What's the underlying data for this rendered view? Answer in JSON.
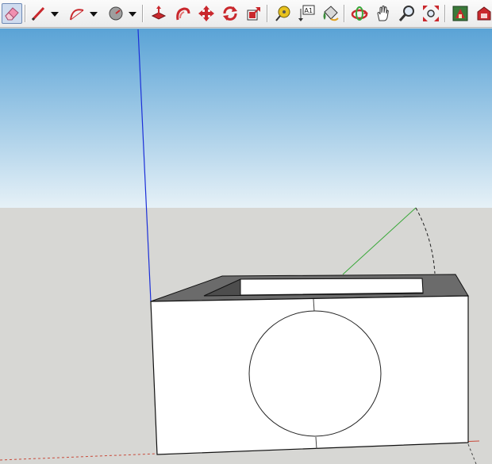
{
  "toolbar": {
    "tools": [
      {
        "id": "eraser",
        "icon": "eraser-icon",
        "active": true
      },
      {
        "id": "pencil-line",
        "icon": "pencil-icon",
        "dropdown": true
      },
      {
        "id": "arc",
        "icon": "arc-icon",
        "dropdown": true
      },
      {
        "id": "shapes",
        "icon": "shapes-icon",
        "dropdown": true
      },
      {
        "id": "push-pull",
        "icon": "push-pull-icon"
      },
      {
        "id": "follow-me",
        "icon": "follow-me-icon"
      },
      {
        "id": "move",
        "icon": "move-icon"
      },
      {
        "id": "rotate",
        "icon": "rotate-icon"
      },
      {
        "id": "scale",
        "icon": "scale-icon"
      },
      {
        "id": "tape-measure",
        "icon": "tape-measure-icon"
      },
      {
        "id": "text",
        "icon": "text-icon",
        "glyph": "A1"
      },
      {
        "id": "paint-bucket",
        "icon": "paint-bucket-icon"
      },
      {
        "id": "orbit",
        "icon": "orbit-icon"
      },
      {
        "id": "pan",
        "icon": "pan-hand-icon"
      },
      {
        "id": "zoom",
        "icon": "zoom-icon"
      },
      {
        "id": "zoom-extents",
        "icon": "zoom-extents-icon"
      },
      {
        "id": "warehouse",
        "icon": "warehouse-icon"
      },
      {
        "id": "extension-warehouse",
        "icon": "extension-warehouse-icon"
      }
    ]
  },
  "colors": {
    "sky_top": "#5aa3d6",
    "sky_bottom": "#e6f1f7",
    "ground": "#d7d7d4",
    "axis_blue": "#1b2fd8",
    "axis_green": "#3aa83a",
    "axis_red": "#c84a3a",
    "face_front": "#ffffff",
    "face_top": "#6b6b6b",
    "edge": "#111111",
    "active_tool_bg": "#cfdcef"
  }
}
